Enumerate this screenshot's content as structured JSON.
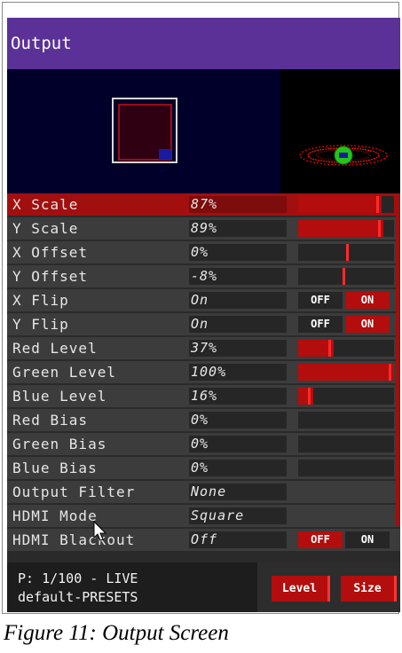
{
  "app": {
    "title": "Output"
  },
  "colors": {
    "accent": "#b30d0d",
    "titlebar": "#5b3197",
    "selected_row": "#a10f0f"
  },
  "rows": [
    {
      "label": "X Scale",
      "value": "87%",
      "control": "slider",
      "level": 0.87,
      "selected": true
    },
    {
      "label": "Y Scale",
      "value": "89%",
      "control": "slider",
      "level": 0.89
    },
    {
      "label": "X Offset",
      "value": "0%",
      "control": "slider",
      "level": 0.0
    },
    {
      "label": "Y Offset",
      "value": "-8%",
      "control": "slider",
      "level": -0.08
    },
    {
      "label": "X Flip",
      "value": "On",
      "control": "toggle",
      "state": "ON"
    },
    {
      "label": "Y Flip",
      "value": "On",
      "control": "toggle",
      "state": "ON"
    },
    {
      "label": "Red Level",
      "value": "37%",
      "control": "slider",
      "level": 0.37
    },
    {
      "label": "Green Level",
      "value": "100%",
      "control": "slider",
      "level": 1.0
    },
    {
      "label": "Blue Level",
      "value": "16%",
      "control": "slider",
      "level": 0.16
    },
    {
      "label": "Red Bias",
      "value": "0%",
      "control": "slider",
      "level": 0.0
    },
    {
      "label": "Green Bias",
      "value": "0%",
      "control": "slider",
      "level": 0.0
    },
    {
      "label": "Blue Bias",
      "value": "0%",
      "control": "slider",
      "level": 0.0
    },
    {
      "label": "Output Filter",
      "value": "None",
      "control": "none"
    },
    {
      "label": "HDMI Mode",
      "value": "Square",
      "control": "none"
    },
    {
      "label": "HDMI Blackout",
      "value": "Off",
      "control": "toggle",
      "state": "OFF"
    }
  ],
  "toggle_labels": {
    "off": "OFF",
    "on": "ON"
  },
  "status": {
    "line1": "P: 1/100 - LIVE",
    "line2": "default-PRESETS"
  },
  "buttons": {
    "level": "Level",
    "size": "Size"
  },
  "caption": "Figure 11: Output Screen"
}
